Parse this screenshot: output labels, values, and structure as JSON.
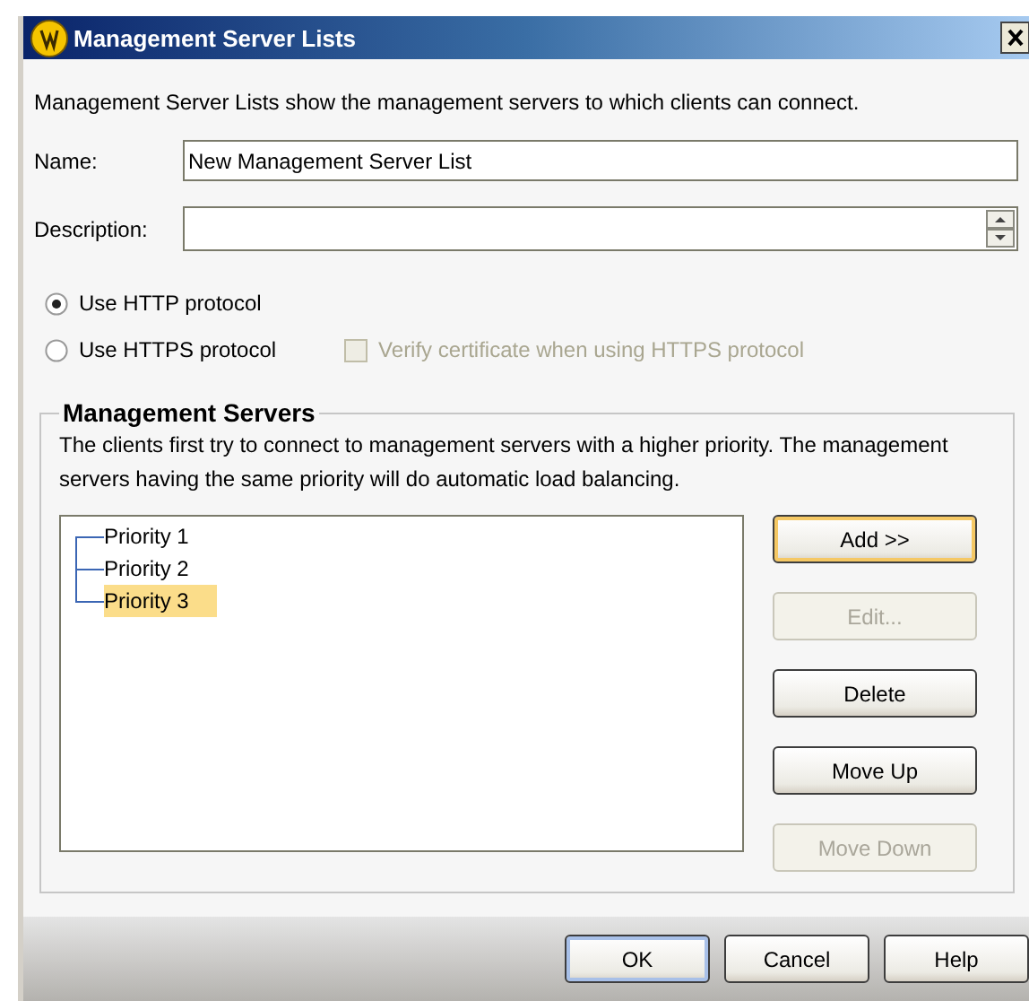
{
  "window": {
    "title": "Management Server Lists"
  },
  "intro": "Management Server Lists show the management servers to which clients can connect.",
  "fields": [
    {
      "label": "Name:",
      "value": "New Management Server List",
      "kind": "text"
    },
    {
      "label": "Description:",
      "kind": "spinner"
    }
  ],
  "protocols": [
    {
      "label": "Use HTTP protocol",
      "selected": true
    },
    {
      "label": "Use HTTPS protocol",
      "selected": false
    }
  ],
  "verify_certificate": {
    "label": "Verify certificate when using HTTPS protocol",
    "checked": false,
    "disabled": true
  },
  "servers_group": {
    "title": "Management Servers",
    "description": "The clients first try to connect to management servers with a higher priority. The management servers having the same priority will do automatic load balancing.",
    "tree": [
      {
        "label": "Priority 1",
        "selected": false
      },
      {
        "label": "Priority 2",
        "selected": false
      },
      {
        "label": "Priority 3",
        "selected": true
      }
    ],
    "buttons": [
      {
        "label": "Add >>",
        "disabled": false,
        "focused": true
      },
      {
        "label": "Edit...",
        "disabled": true,
        "focused": false
      },
      {
        "label": "Delete",
        "disabled": false,
        "focused": false
      },
      {
        "label": "Move Up",
        "disabled": false,
        "focused": false
      },
      {
        "label": "Move Down",
        "disabled": true,
        "focused": false
      }
    ]
  },
  "buttons": [
    {
      "label": "OK",
      "disabled": false,
      "focused": true
    },
    {
      "label": "Cancel",
      "disabled": false,
      "focused": false
    },
    {
      "label": "Help",
      "disabled": false,
      "focused": false
    }
  ]
}
